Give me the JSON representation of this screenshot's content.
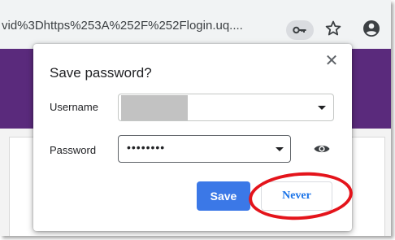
{
  "omnibox": {
    "url_text": "vid%3Dhttps%253A%252F%252Flogin.uq....",
    "key_icon": "key-icon",
    "star_icon": "star-icon",
    "account_icon": "account-circle-icon"
  },
  "dialog": {
    "title": "Save password?",
    "close_glyph": "✕",
    "username": {
      "label": "Username",
      "value": ""
    },
    "password": {
      "label": "Password",
      "value": "••••••••"
    },
    "buttons": {
      "save_label": "Save",
      "never_label": "Never"
    }
  },
  "colors": {
    "page_band": "#5a2a7c",
    "save_button": "#3b78e7",
    "never_text": "#1a73e8",
    "highlight": "#e4141b"
  }
}
